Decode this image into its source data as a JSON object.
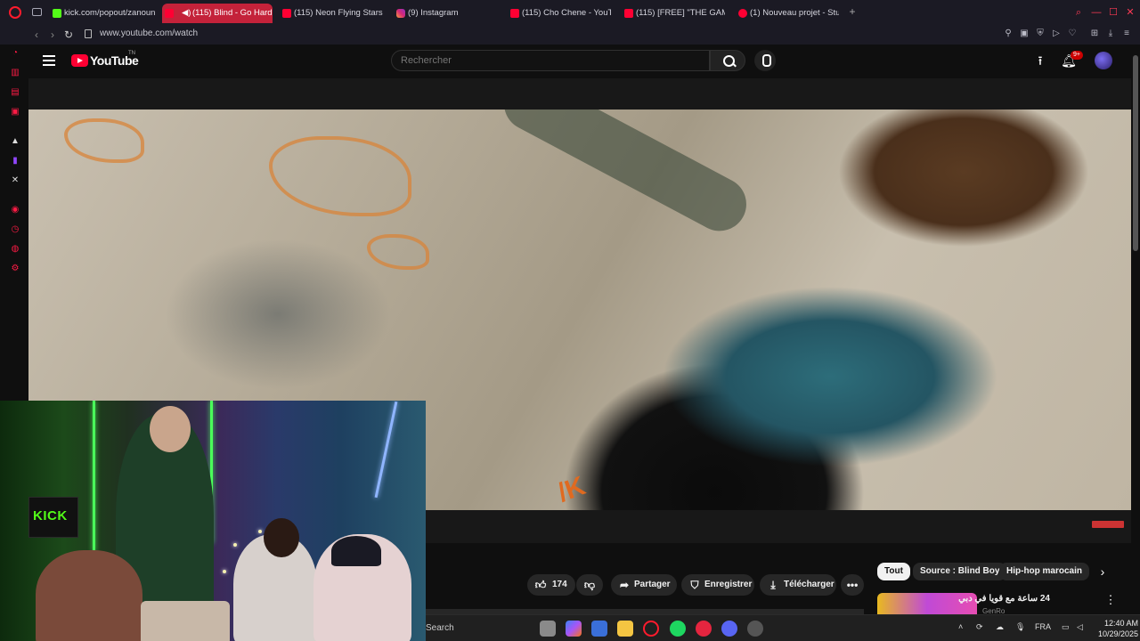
{
  "browser": {
    "tabs": [
      {
        "label": "kick.com/popout/zanoun",
        "favicon": "kick",
        "active": false
      },
      {
        "label": "(115) Blind - Go Hard",
        "favicon": "youtube",
        "active": true
      },
      {
        "label": "(115) Neon Flying Stars B",
        "favicon": "youtube",
        "active": false
      },
      {
        "label": "(9) Instagram",
        "favicon": "instagram",
        "active": false
      },
      {
        "label": "(115) Cho Chene - YouTu",
        "favicon": "youtube",
        "active": false
      },
      {
        "label": "(115) [FREE] \"THE GAME\"",
        "favicon": "youtube",
        "active": false
      },
      {
        "label": "(1) Nouveau projet - Studi",
        "favicon": "studio",
        "active": false
      }
    ],
    "url": "www.youtube.com/watch",
    "accent_color": "#ff1b45"
  },
  "youtube": {
    "logo_text": "YouTube",
    "logo_tm": "TN",
    "search_placeholder": "Rechercher",
    "notification_badge": "9+"
  },
  "actions": {
    "likes": "174",
    "share": "Partager",
    "save": "Enregistrer",
    "download": "Télécharger"
  },
  "chips": [
    "Tout",
    "Source : Blind Boy",
    "Hip-hop marocain"
  ],
  "recommended": {
    "title": "24 ساعة مع قويا في دبي",
    "channel": "GenRo"
  },
  "webcam": {
    "kick_sign": "KICK"
  },
  "taskbar": {
    "search_label": "Search",
    "language": "FRA",
    "time": "12:40 AM",
    "date": "10/29/2025"
  }
}
